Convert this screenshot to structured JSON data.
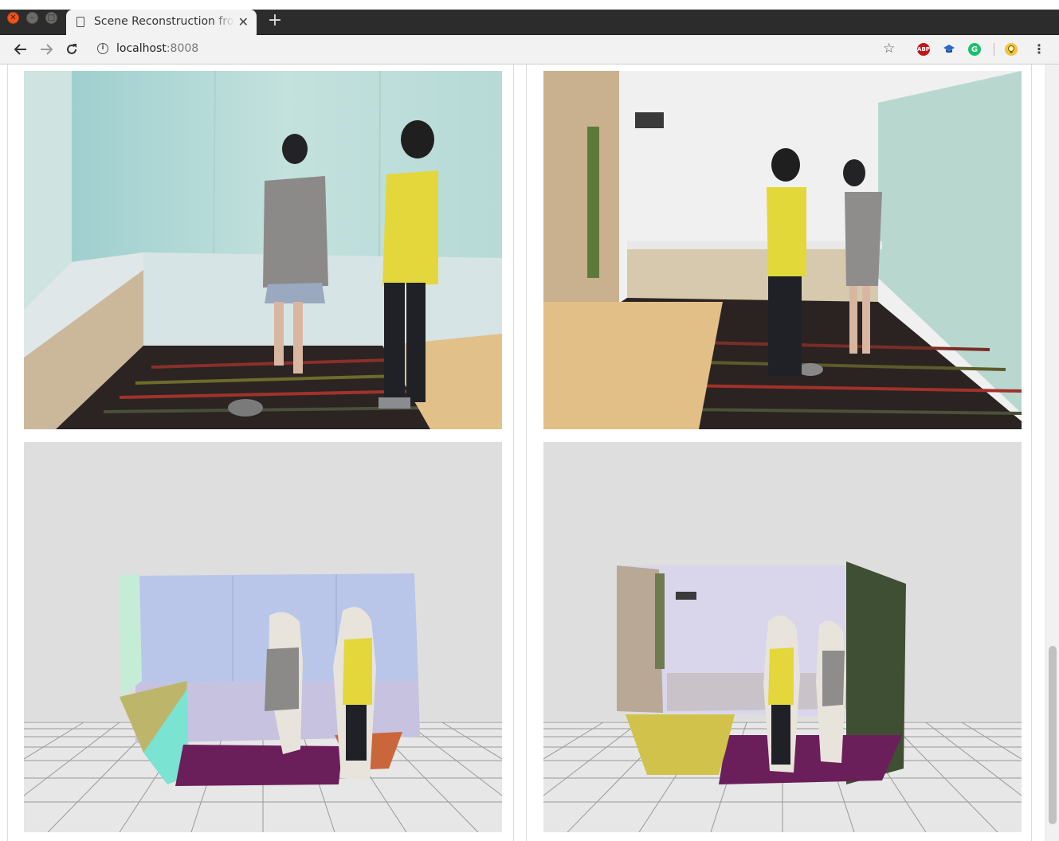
{
  "browser": {
    "tab_title": "Scene Reconstruction from",
    "tab_close": "✕",
    "new_tab": "+",
    "url_host": "localhost",
    "url_port": ":8008",
    "extensions": {
      "abp": "ABP",
      "grammarly": "G"
    }
  },
  "page": {
    "images": [
      {
        "name": "input-photo-1",
        "alt": "Input photo 1"
      },
      {
        "name": "input-photo-2",
        "alt": "Input photo 2"
      },
      {
        "name": "reconstruction-1",
        "alt": "3D reconstruction 1"
      },
      {
        "name": "reconstruction-2",
        "alt": "3D reconstruction 2"
      }
    ]
  },
  "colors": {
    "chrome_dark": "#2c2c2c",
    "toolbar": "#f2f2f2",
    "canvas_bg": "#dedede"
  }
}
